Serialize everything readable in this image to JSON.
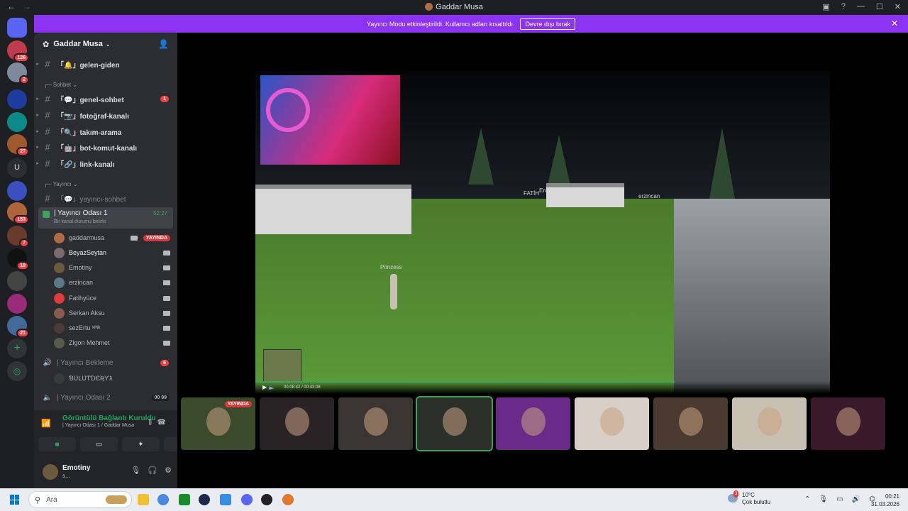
{
  "titlebar": {
    "title": "Gaddar Musa",
    "back": "←",
    "forward": "→"
  },
  "servers": [
    {
      "color": "#5865f2",
      "badge": "",
      "icon": "discord"
    },
    {
      "color": "#c03b4b",
      "badge": "126"
    },
    {
      "color": "#7d8a9c",
      "badge": "2"
    },
    {
      "color": "#1c3ca0",
      "badge": ""
    },
    {
      "color": "#0c8a8a",
      "badge": ""
    },
    {
      "color": "#a05a2c",
      "badge": "27"
    },
    {
      "color": "#2b2d31",
      "badge": "",
      "letter": "U"
    },
    {
      "color": "#3a50c0",
      "badge": ""
    },
    {
      "color": "#b0643a",
      "badge": "153"
    },
    {
      "color": "#6a3a2a",
      "badge": "7"
    },
    {
      "color": "#111111",
      "badge": "10"
    },
    {
      "color": "#444444",
      "badge": ""
    },
    {
      "color": "#9a2a7a",
      "badge": ""
    },
    {
      "color": "#406a9a",
      "badge": "21"
    }
  ],
  "banner": {
    "text": "Yayıncı Modu etkinleştirildi. Kullanıcı adları kısaltıldı.",
    "button": "Devre dışı bırak"
  },
  "guild": {
    "name": "Gaddar Musa"
  },
  "channels": {
    "c0": "「🔔」gelen-giden",
    "cat_sohbet": "Sohbet",
    "c1": "「💬」genel-sohbet",
    "c1_unread": "1",
    "c2": "「📷」fotoğraf-kanalı",
    "c3": "「🔍」takım-arama",
    "c4": "「🤖」bot-komut-kanalı",
    "c5": "「🔗」link-kanalı",
    "cat_yayinci": "Yayıncı",
    "c6": "「💬」yayıncı-sohbet",
    "voice1": "| Yayıncı Odası 1",
    "voice1_time": "52:27",
    "voice1_status": "Bir kanal durumu belirle",
    "wait": "| Yayıncı Bekleme",
    "wait_count": "6",
    "wait_user": "ƁƲLƲƬƊЄƦƳƛ",
    "voice2": "| Yayıncı Odası 2",
    "voice2_a": "00",
    "voice2_b": "99"
  },
  "users": [
    {
      "name": "gaddarmusa",
      "color": "#b06a45",
      "live": "YAYINDA"
    },
    {
      "name": "BeyazSeytan",
      "color": "#7a6a6a",
      "live": ""
    },
    {
      "name": "Emotiny",
      "color": "#6b5a3d",
      "live": ""
    },
    {
      "name": "erzincan",
      "color": "#5a7a8a",
      "live": ""
    },
    {
      "name": "Fatihyüce",
      "color": "#e03a3a",
      "live": ""
    },
    {
      "name": "Serkan Aksu",
      "color": "#8a5a4a",
      "live": ""
    },
    {
      "name": "sezErtu ᵏᴵᴺᵏ",
      "color": "#4a3a3a",
      "live": ""
    },
    {
      "name": "Zigon Mehmet",
      "color": "#5a5a4a",
      "live": ""
    }
  ],
  "panel": {
    "conn_title": "Görüntülü Bağlantı Kuruldu",
    "conn_sub": "| Yayıncı Odası 1 / Gaddar Musa",
    "user": "Emotiny",
    "user_status": "s..."
  },
  "stream": {
    "names": [
      "Princess",
      "FATİH",
      "Enes",
      "erzincan"
    ],
    "time": "00:08:42 / 00:43:08",
    "progress": 0.73
  },
  "tiles": [
    {
      "bg": "#3a4a2a",
      "live": "YAYINDA"
    },
    {
      "bg": "#2a2326",
      "live": ""
    },
    {
      "bg": "#3a3530",
      "live": ""
    },
    {
      "bg": "#2c2f2a",
      "live": ""
    },
    {
      "bg": "#6a2a8a",
      "live": ""
    },
    {
      "bg": "#d8d0c8",
      "live": ""
    },
    {
      "bg": "#4a3a30",
      "live": ""
    },
    {
      "bg": "#c8c0b0",
      "live": ""
    },
    {
      "bg": "#3a1a2a",
      "live": ""
    }
  ],
  "taskbar": {
    "search": "Ara",
    "weather_temp": "10°C",
    "weather_desc": "Çok bulutlu",
    "weather_badge": "3",
    "time": "00:21",
    "date": "31.03.2026"
  }
}
